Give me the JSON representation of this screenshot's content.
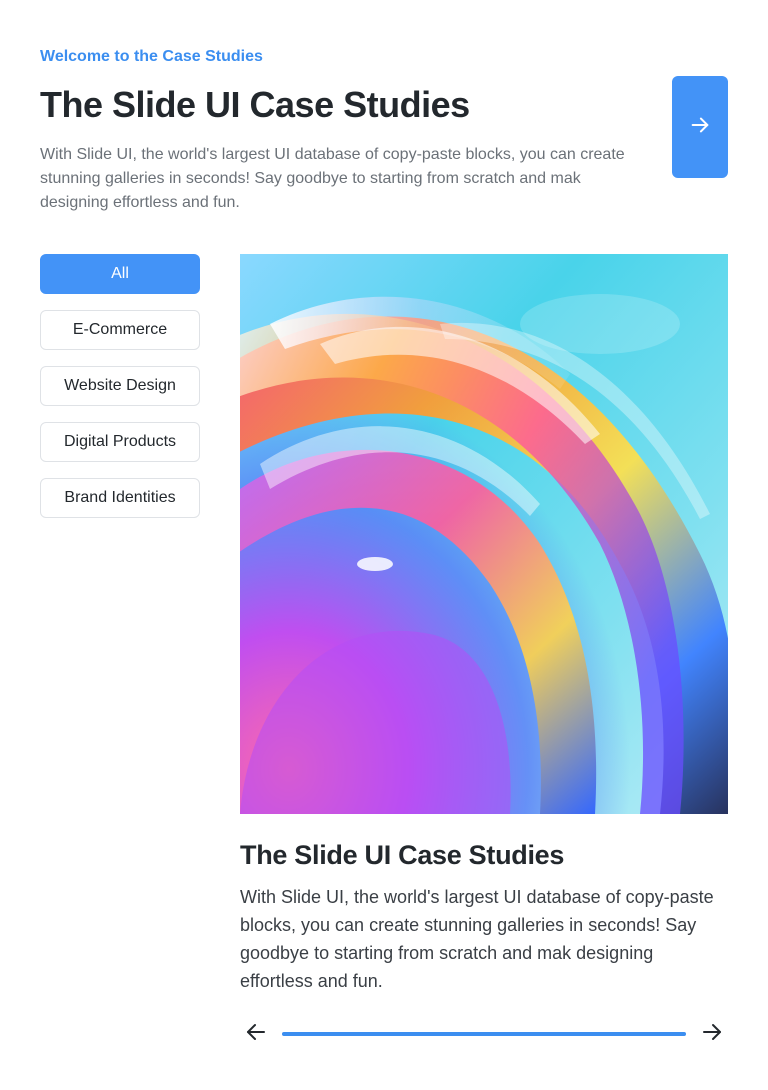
{
  "header": {
    "eyebrow": "Welcome to the Case Studies",
    "title": "The Slide UI Case Studies",
    "intro": "With Slide UI, the world's largest UI database of copy-paste blocks, you can create stunning galleries in seconds! Say goodbye to starting from scratch and mak designing effortless and fun.",
    "cta_icon": "arrow-right-icon"
  },
  "filters": [
    {
      "label": "All",
      "active": true
    },
    {
      "label": "E-Commerce",
      "active": false
    },
    {
      "label": "Website Design",
      "active": false
    },
    {
      "label": "Digital Products",
      "active": false
    },
    {
      "label": "Brand Identities",
      "active": false
    }
  ],
  "card": {
    "image": "abstract-iridescent-glass-swirl",
    "title": "The Slide UI Case Studies",
    "text": "With Slide UI, the world's largest UI database of copy-paste blocks, you can create stunning galleries in seconds! Say goodbye to starting from scratch and mak designing effortless and fun."
  },
  "slider": {
    "prev_icon": "arrow-left-icon",
    "next_icon": "arrow-right-icon",
    "progress": 1.0
  },
  "colors": {
    "accent": "#4393f7",
    "eyebrow": "#3b8ef0",
    "heading": "#23282d",
    "muted_text": "#6b7178"
  }
}
